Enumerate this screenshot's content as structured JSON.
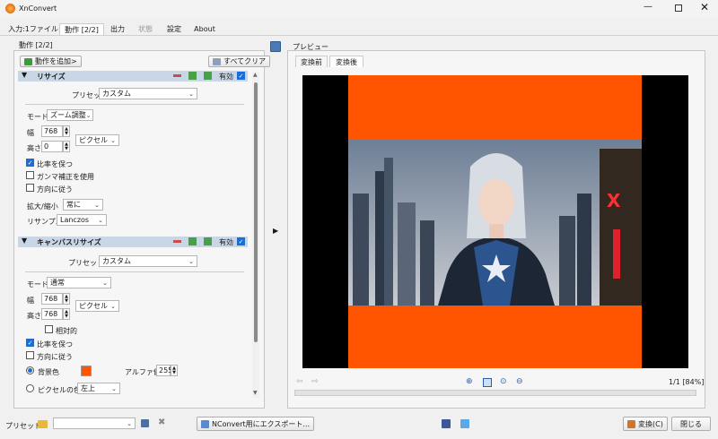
{
  "window": {
    "title": "XnConvert"
  },
  "tabs": [
    "入力:1ファイル",
    "動作 [2/2]",
    "出力",
    "状態",
    "設定",
    "About"
  ],
  "actions_panel": {
    "title": "動作 [2/2]",
    "add_action": "動作を追加>",
    "clear_all": "すべてクリア",
    "resize": {
      "title": "リサイズ",
      "enabled_label": "有効",
      "preset_label": "プリセット",
      "preset_value": "カスタム",
      "mode_label": "モード",
      "mode_value": "ズーム調整",
      "width_label": "幅",
      "width_value": "768",
      "height_label": "高さ",
      "height_value": "0",
      "unit_value": "ピクセル",
      "keep_ratio": "比率を保つ",
      "gamma": "ガンマ補正を使用",
      "orientation": "方向に従う",
      "enlarge_label": "拡大/縮小",
      "enlarge_value": "常に",
      "resample_label": "リサンプル",
      "resample_value": "Lanczos"
    },
    "canvas": {
      "title": "キャンバスリサイズ",
      "enabled_label": "有効",
      "preset_label": "プリセット",
      "preset_value": "カスタム",
      "mode_label": "モード",
      "mode_value": "通常",
      "width_label": "幅",
      "width_value": "768",
      "height_label": "高さ",
      "height_value": "768",
      "unit_value": "ピクセル",
      "relative": "相対的",
      "keep_ratio": "比率を保つ",
      "orientation": "方向に従う",
      "bg_color": "背景色",
      "bg_color_value": "#ff5500",
      "alpha_label": "アルファ値",
      "alpha_value": "255",
      "pixel_color": "ピクセルの色",
      "pixel_color_value": "左上"
    }
  },
  "preview": {
    "title": "プレビュー",
    "tab_before": "変換前",
    "tab_after": "変換後",
    "page_info": "1/1 [84%]",
    "canvas_color": "#ff5500",
    "sign_text": "X"
  },
  "bottom": {
    "preset_label": "プリセット:",
    "preset_value": "",
    "export_label": "NConvert用にエクスポート...",
    "convert_label": "変換(C)",
    "close_label": "閉じる"
  }
}
